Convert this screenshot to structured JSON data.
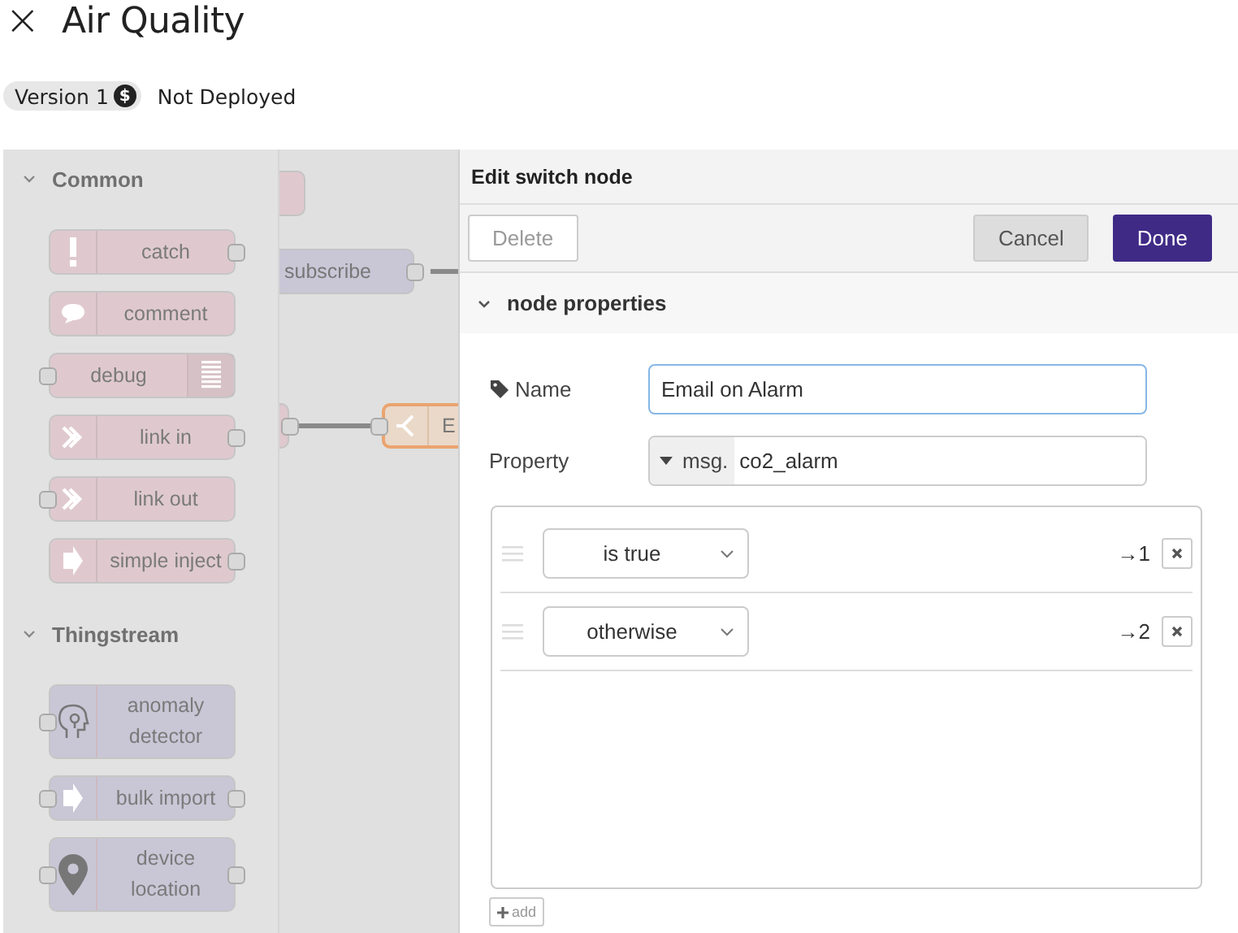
{
  "header": {
    "close": "×",
    "title": "Air Quality",
    "version": {
      "label": "Version 1",
      "plan_mark": "$"
    },
    "status": "Not Deployed"
  },
  "palette": {
    "categories": [
      {
        "name": "Common",
        "expanded": true,
        "color": "#dfc9cf",
        "nodes": [
          {
            "label": "catch",
            "kind": "exclamation",
            "input": false,
            "output": true
          },
          {
            "label": "comment",
            "kind": "speech",
            "input": false,
            "output": false
          },
          {
            "label": "debug",
            "kind": "lines",
            "input": true,
            "output": false
          },
          {
            "label": "link in",
            "kind": "link",
            "input": false,
            "output": true
          },
          {
            "label": "link out",
            "kind": "link",
            "input": true,
            "output": false
          },
          {
            "label": "simple inject",
            "kind": "arrow",
            "input": false,
            "output": true
          }
        ]
      },
      {
        "name": "Thingstream",
        "expanded": true,
        "color": "#c9c7d6",
        "nodes": [
          {
            "label": "anomaly detector",
            "kind": "head",
            "input": true,
            "output": false
          },
          {
            "label": "bulk import",
            "kind": "arrow",
            "input": true,
            "output": true
          },
          {
            "label": "device location",
            "kind": "pin",
            "input": true,
            "output": true
          }
        ]
      }
    ]
  },
  "canvas": {
    "nodes": [
      {
        "kind": "block",
        "color": "#dfc9cf"
      },
      {
        "kind": "labeled",
        "label": "subscribe",
        "color": "#c9c7d6"
      },
      {
        "kind": "stub",
        "color": "#dfc9cf"
      },
      {
        "kind": "switch",
        "label": "E",
        "color": "#ead8c8"
      }
    ]
  },
  "editor": {
    "title": "Edit switch node",
    "buttons": [
      {
        "label": "Delete",
        "kind": "plain"
      },
      {
        "label": "Cancel",
        "kind": "secondary"
      },
      {
        "label": "Done",
        "kind": "primary"
      }
    ],
    "section": {
      "title": "node properties",
      "expanded": true
    },
    "name": {
      "label": "Name",
      "value": "Email on Alarm"
    },
    "property": {
      "label": "Property",
      "prefix": "msg.",
      "value": "co2_alarm"
    },
    "rules": [
      {
        "condition": "is true",
        "output": "→1"
      },
      {
        "condition": "otherwise",
        "output": "→2"
      }
    ],
    "add": "add"
  }
}
